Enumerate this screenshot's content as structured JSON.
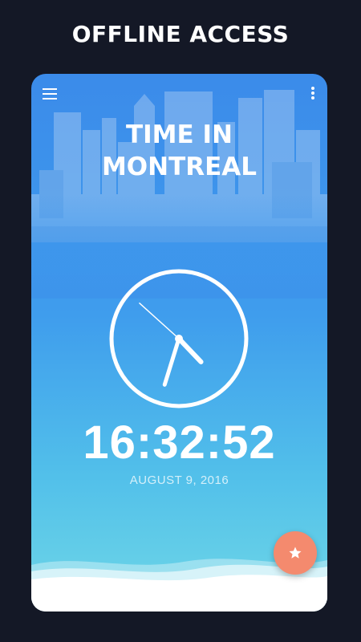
{
  "promo": {
    "headline": "OFFLINE ACCESS"
  },
  "app": {
    "title_line1": "TIME IN",
    "title_line2": "MONTREAL",
    "time": "16:32:52",
    "date": "AUGUST 9, 2016",
    "clock": {
      "hours": 16,
      "minutes": 32,
      "seconds": 52
    },
    "icons": {
      "menu": "menu-icon",
      "overflow": "more-vert-icon",
      "favorite": "star-icon"
    },
    "colors": {
      "gradient_top": "#3b8bea",
      "gradient_bottom": "#6fd7e6",
      "fab": "#f48a6e",
      "background": "#141826"
    }
  }
}
